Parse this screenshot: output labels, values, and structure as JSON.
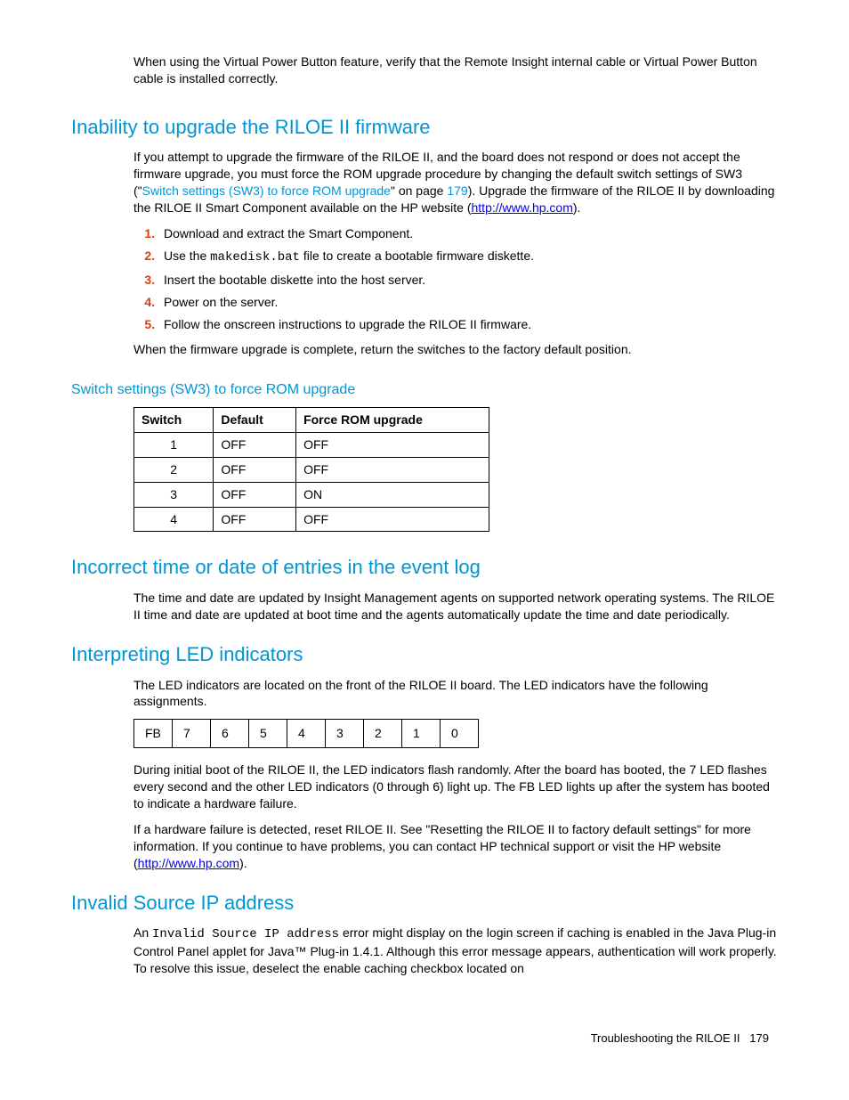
{
  "intro": "When using the Virtual Power Button feature, verify that the Remote Insight internal cable or Virtual Power Button cable is installed correctly.",
  "s1": {
    "heading": "Inability to upgrade the RILOE II firmware",
    "p1a": "If you attempt to upgrade the firmware of the RILOE II, and the board does not respond or does not accept the firmware upgrade, you must force the ROM upgrade procedure by changing the default switch settings of SW3 (\"",
    "xref": "Switch settings (SW3) to force ROM upgrade",
    "p1b": "\" on page ",
    "xrefpage": "179",
    "p1c": "). Upgrade the firmware of the RILOE II by downloading the RILOE II Smart Component available on the HP website (",
    "link": "http://www.hp.com",
    "p1d": ").",
    "steps": {
      "a": "Download and extract the Smart Component.",
      "b_pre": "Use the ",
      "b_code": "makedisk.bat",
      "b_post": " file to create a bootable firmware diskette.",
      "c": "Insert the bootable diskette into the host server.",
      "d": "Power on the server.",
      "e": "Follow the onscreen instructions to upgrade the RILOE II firmware."
    },
    "p2": "When the firmware upgrade is complete, return the switches to the factory default position."
  },
  "s2": {
    "heading": "Switch settings (SW3) to force ROM upgrade",
    "headers": {
      "a": "Switch",
      "b": "Default",
      "c": "Force ROM upgrade"
    },
    "rows": {
      "r1": {
        "a": "1",
        "b": "OFF",
        "c": "OFF"
      },
      "r2": {
        "a": "2",
        "b": "OFF",
        "c": "OFF"
      },
      "r3": {
        "a": "3",
        "b": "OFF",
        "c": "ON"
      },
      "r4": {
        "a": "4",
        "b": "OFF",
        "c": "OFF"
      }
    }
  },
  "s3": {
    "heading": "Incorrect time or date of entries in the event log",
    "p1": "The time and date are updated by Insight Management agents on supported network operating systems. The RILOE II time and date are updated at boot time and the agents automatically update the time and date periodically."
  },
  "s4": {
    "heading": "Interpreting LED indicators",
    "p1": "The LED indicators are located on the front of the RILOE II board. The LED indicators have the following assignments.",
    "led": {
      "a": "FB",
      "b": "7",
      "c": "6",
      "d": "5",
      "e": "4",
      "f": "3",
      "g": "2",
      "h": "1",
      "i": "0"
    },
    "p2": "During initial boot of the RILOE II, the LED indicators flash randomly. After the board has booted, the 7 LED flashes every second and the other LED indicators (0 through 6) light up. The FB LED lights up after the system has booted to indicate a hardware failure.",
    "p3a": "If a hardware failure is detected, reset RILOE II. See \"Resetting the RILOE II to factory default settings\" for more information. If you continue to have problems, you can contact HP technical support or visit the HP website (",
    "link": "http://www.hp.com",
    "p3b": ")."
  },
  "s5": {
    "heading": "Invalid Source IP address",
    "p1a": "An ",
    "code": "Invalid Source IP address",
    "p1b": " error might display on the login screen if caching is enabled in the Java Plug-in Control Panel applet for Java™ Plug-in 1.4.1. Although this error message appears, authentication will work properly. To resolve this issue, deselect the enable caching checkbox located on"
  },
  "footer": {
    "text": "Troubleshooting the RILOE II",
    "page": "179"
  }
}
